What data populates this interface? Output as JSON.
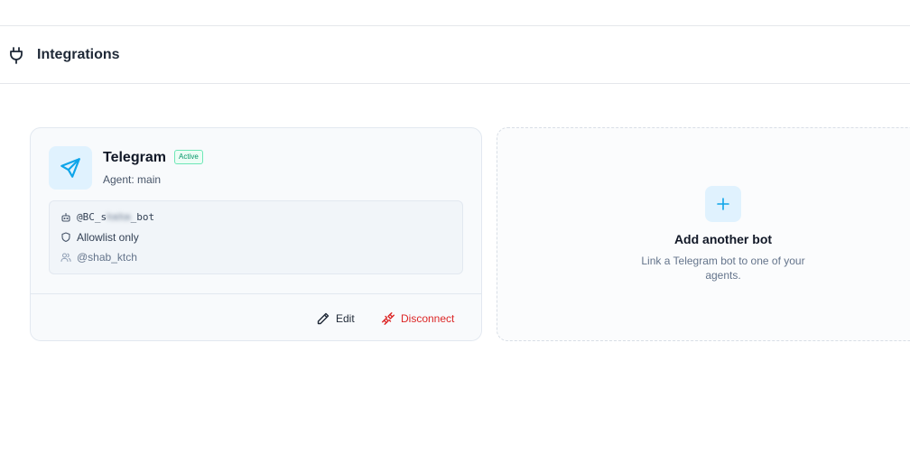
{
  "header": {
    "title": "Integrations",
    "icon": "plug-icon"
  },
  "bot_card": {
    "title": "Telegram",
    "badge": "Active",
    "agent_label": "Agent: main",
    "details": {
      "bot_handle_prefix": "@BC_s",
      "bot_handle_blurred": "hmhm",
      "bot_handle_suffix": "_bot",
      "access_mode": "Allowlist only",
      "allowed_user": "@shab_ktch"
    },
    "actions": {
      "edit": "Edit",
      "disconnect": "Disconnect"
    }
  },
  "add_card": {
    "title": "Add another bot",
    "description": "Link a Telegram bot to one of your agents."
  },
  "colors": {
    "accent": "#0ea5e9",
    "danger": "#dc2626",
    "success": "#059669"
  }
}
